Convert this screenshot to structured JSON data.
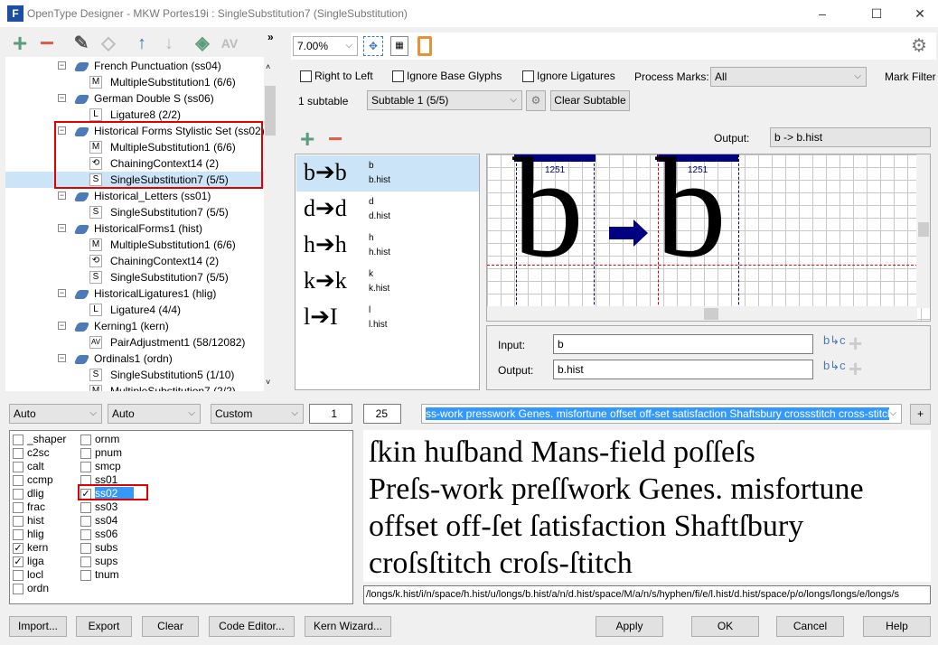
{
  "window": {
    "title": "OpenType Designer - MKW Portes19i : SingleSubstitution7 (SingleSubstitution)",
    "app_icon": "F",
    "minimize": "–",
    "maximize": "☐",
    "close": "✕"
  },
  "left_toolbar": {
    "add": "+",
    "remove": "−",
    "overflow": "»"
  },
  "tree": [
    {
      "level": 1,
      "label": "French Punctuation (ss04)"
    },
    {
      "level": 2,
      "kind": "M",
      "label": "MultipleSubstitution1 (6/6)"
    },
    {
      "level": 1,
      "label": "German Double S (ss06)"
    },
    {
      "level": 2,
      "kind": "L",
      "label": "Ligature8 (2/2)"
    },
    {
      "level": 1,
      "label": "Historical Forms Stylistic Set (ss02)"
    },
    {
      "level": 2,
      "kind": "M",
      "label": "MultipleSubstitution1 (6/6)"
    },
    {
      "level": 2,
      "kind": "C",
      "label": "ChainingContext14 (2)"
    },
    {
      "level": 2,
      "kind": "S",
      "label": "SingleSubstitution7 (5/5)",
      "selected": true
    },
    {
      "level": 1,
      "label": "Historical_Letters (ss01)"
    },
    {
      "level": 2,
      "kind": "S",
      "label": "SingleSubstitution7 (5/5)"
    },
    {
      "level": 1,
      "label": "HistoricalForms1 (hist)"
    },
    {
      "level": 2,
      "kind": "M",
      "label": "MultipleSubstitution1 (6/6)"
    },
    {
      "level": 2,
      "kind": "C",
      "label": "ChainingContext14 (2)"
    },
    {
      "level": 2,
      "kind": "S",
      "label": "SingleSubstitution7 (5/5)"
    },
    {
      "level": 1,
      "label": "HistoricalLigatures1 (hlig)"
    },
    {
      "level": 2,
      "kind": "L",
      "label": "Ligature4 (4/4)"
    },
    {
      "level": 1,
      "label": "Kerning1 (kern)"
    },
    {
      "level": 2,
      "kind": "AV",
      "label": "PairAdjustment1 (58/12082)"
    },
    {
      "level": 1,
      "label": "Ordinals1 (ordn)"
    },
    {
      "level": 2,
      "kind": "S",
      "label": "SingleSubstitution5 (1/10)"
    },
    {
      "level": 2,
      "kind": "M",
      "label": "MultipleSubstitution7 (2/2)"
    }
  ],
  "right_toolbar": {
    "zoom": "7.00%"
  },
  "options": {
    "right_to_left": "Right to Left",
    "ignore_base": "Ignore Base Glyphs",
    "ignore_ligatures": "Ignore Ligatures",
    "process_marks_label": "Process Marks:",
    "process_marks_value": "All",
    "mark_filter": "Mark Filter"
  },
  "subtable": {
    "count": "1 subtable",
    "selected": "Subtable 1 (5/5)",
    "clear": "Clear Subtable"
  },
  "output_label": "Output:",
  "output_value": "b -> b.hist",
  "substitutions": [
    {
      "big": "b➔b",
      "input": "b",
      "output": "b.hist"
    },
    {
      "big": "d➔d",
      "input": "d",
      "output": "d.hist"
    },
    {
      "big": "h➔h",
      "input": "h",
      "output": "h.hist"
    },
    {
      "big": "k➔k",
      "input": "k",
      "output": "k.hist"
    },
    {
      "big": "l➔I",
      "input": "l",
      "output": "l.hist"
    }
  ],
  "canvas": {
    "glyph_in": "b",
    "glyph_out": "b",
    "advance_in": "1251",
    "advance_out": "1251",
    "bar_color": "#000080"
  },
  "edit": {
    "input_label": "Input:",
    "input_value": "b",
    "output_label": "Output:",
    "output_value": "b.hist"
  },
  "bottom_controls": {
    "script": "Auto",
    "language": "Auto",
    "mode": "Custom",
    "count": "1",
    "size": "25",
    "text": "ss-work presswork Genes. misfortune offset off-set satisfaction Shaftsbury crossstitch cross-stitch",
    "plus": "+"
  },
  "features": [
    {
      "tag": "_shaper",
      "checked": false
    },
    {
      "tag": "c2sc",
      "checked": false
    },
    {
      "tag": "calt",
      "checked": false
    },
    {
      "tag": "ccmp",
      "checked": false
    },
    {
      "tag": "dlig",
      "checked": false
    },
    {
      "tag": "frac",
      "checked": false
    },
    {
      "tag": "hist",
      "checked": false
    },
    {
      "tag": "hlig",
      "checked": false
    },
    {
      "tag": "kern",
      "checked": true
    },
    {
      "tag": "liga",
      "checked": true
    },
    {
      "tag": "locl",
      "checked": false
    },
    {
      "tag": "ordn",
      "checked": false
    },
    {
      "tag": "ornm",
      "checked": false
    },
    {
      "tag": "pnum",
      "checked": false
    },
    {
      "tag": "smcp",
      "checked": false
    },
    {
      "tag": "ss01",
      "checked": false
    },
    {
      "tag": "ss02",
      "checked": true,
      "selected": true
    },
    {
      "tag": "ss03",
      "checked": false
    },
    {
      "tag": "ss04",
      "checked": false
    },
    {
      "tag": "ss06",
      "checked": false
    },
    {
      "tag": "subs",
      "checked": false
    },
    {
      "tag": "sups",
      "checked": false
    },
    {
      "tag": "tnum",
      "checked": false
    }
  ],
  "preview_lines": [
    "ſkin huſband Mans-field poſſeſs",
    "Preſs-work preſſwork Genes. misfortune",
    "offset off-ſet ſatisfaction Shaftſbury",
    "croſsſtitch croſs-ſtitch"
  ],
  "glyph_path": "/longs/k.hist/i/n/space/h.hist/u/longs/b.hist/a/n/d.hist/space/M/a/n/s/hyphen/fi/e/l.hist/d.hist/space/p/o/longs/longs/e/longs/s",
  "buttons": {
    "import": "Import...",
    "export": "Export",
    "clear": "Clear",
    "code_editor": "Code Editor...",
    "kern_wizard": "Kern Wizard...",
    "apply": "Apply",
    "ok": "OK",
    "cancel": "Cancel",
    "help": "Help"
  },
  "colors": {
    "add": "#5a9e7e",
    "remove": "#d9604a",
    "selection": "#cce4f7",
    "highlight": "#3399ff",
    "annotation": "#e00000"
  }
}
